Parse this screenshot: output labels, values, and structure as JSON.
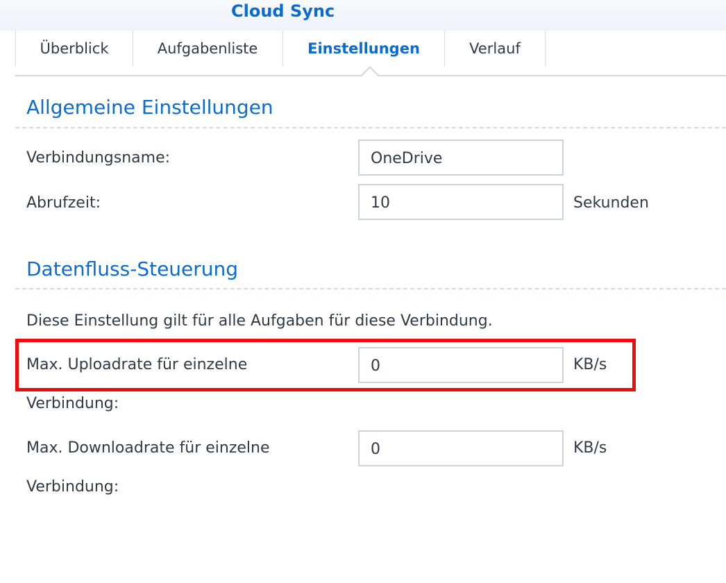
{
  "app": {
    "title": "Cloud Sync"
  },
  "tabs": [
    {
      "label": "Überblick"
    },
    {
      "label": "Aufgabenliste"
    },
    {
      "label": "Einstellungen"
    },
    {
      "label": "Verlauf"
    }
  ],
  "general": {
    "title": "Allgemeine Einstellungen",
    "connection_name_label": "Verbindungsname:",
    "connection_name_value": "OneDrive",
    "polling_label": "Abrufzeit:",
    "polling_value": "10",
    "polling_unit": "Sekunden"
  },
  "flow": {
    "title": "Datenfluss-Steuerung",
    "description": "Diese Einstellung gilt für alle Aufgaben für diese Verbindung.",
    "upload_label_line1": "Max. Uploadrate für einzelne",
    "upload_label_line2": "Verbindung:",
    "upload_value": "0",
    "upload_unit": "KB/s",
    "download_label_line1": "Max. Downloadrate für einzelne",
    "download_label_line2": "Verbindung:",
    "download_value": "0",
    "download_unit": "KB/s"
  },
  "colors": {
    "accent": "#0a6cd0",
    "highlight": "#ee0d0d"
  }
}
